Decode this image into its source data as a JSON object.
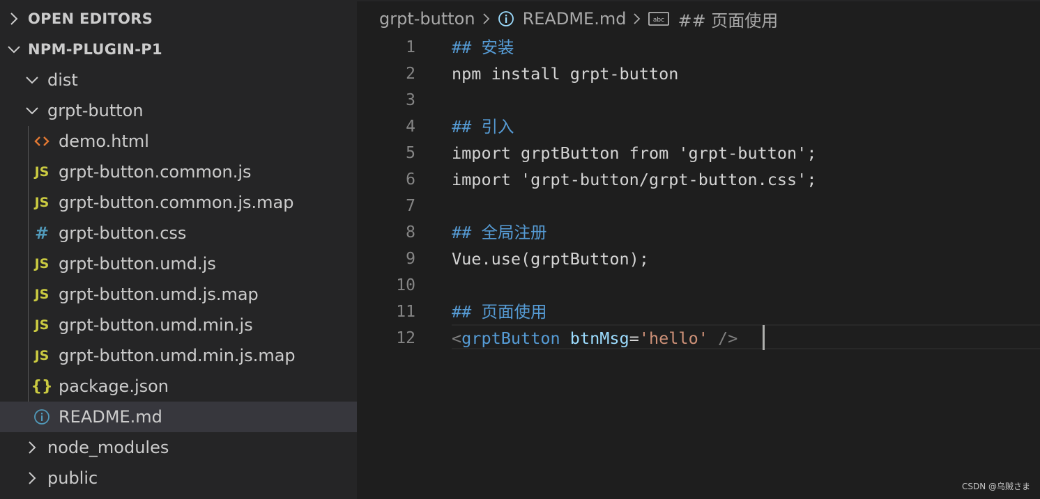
{
  "explorer": {
    "open_editors_label": "OPEN EDITORS",
    "project_label": "NPM-PLUGIN-P1",
    "tree": [
      {
        "label": "dist",
        "kind": "folder",
        "state": "expanded"
      },
      {
        "label": "grpt-button",
        "kind": "folder",
        "state": "expanded"
      },
      {
        "label": "demo.html",
        "kind": "file",
        "icon": "html-icon",
        "icon_text": "<>"
      },
      {
        "label": "grpt-button.common.js",
        "kind": "file",
        "icon": "js-icon",
        "icon_text": "JS"
      },
      {
        "label": "grpt-button.common.js.map",
        "kind": "file",
        "icon": "js-icon",
        "icon_text": "JS"
      },
      {
        "label": "grpt-button.css",
        "kind": "file",
        "icon": "css-icon",
        "icon_text": "#"
      },
      {
        "label": "grpt-button.umd.js",
        "kind": "file",
        "icon": "js-icon",
        "icon_text": "JS"
      },
      {
        "label": "grpt-button.umd.js.map",
        "kind": "file",
        "icon": "js-icon",
        "icon_text": "JS"
      },
      {
        "label": "grpt-button.umd.min.js",
        "kind": "file",
        "icon": "js-icon",
        "icon_text": "JS"
      },
      {
        "label": "grpt-button.umd.min.js.map",
        "kind": "file",
        "icon": "js-icon",
        "icon_text": "JS"
      },
      {
        "label": "package.json",
        "kind": "file",
        "icon": "json-icon",
        "icon_text": "{}"
      },
      {
        "label": "README.md",
        "kind": "file",
        "icon": "info-icon",
        "selected": true
      },
      {
        "label": "node_modules",
        "kind": "folder",
        "state": "collapsed"
      },
      {
        "label": "public",
        "kind": "folder",
        "state": "collapsed"
      }
    ]
  },
  "breadcrumb": {
    "folder": "grpt-button",
    "file": "README.md",
    "symbol": "## 页面使用"
  },
  "editor": {
    "line_numbers": [
      "1",
      "2",
      "3",
      "4",
      "5",
      "6",
      "7",
      "8",
      "9",
      "10",
      "11",
      "12"
    ],
    "lines": {
      "l1_hash": "## ",
      "l1_text": "安装",
      "l2": "npm install grpt-button",
      "l4_hash": "## ",
      "l4_text": "引入",
      "l5": "import grptButton from 'grpt-button';",
      "l6": "import 'grpt-button/grpt-button.css';",
      "l8_hash": "## ",
      "l8_text": "全局注册",
      "l9": "Vue.use(grptButton);",
      "l11_hash": "## ",
      "l11_text": "页面使用",
      "l12_open": "<",
      "l12_tag": "grptButton",
      "l12_space": " ",
      "l12_attr": "btnMsg",
      "l12_eq": "=",
      "l12_val": "'hello'",
      "l12_close": " />"
    }
  },
  "watermark": "CSDN @乌贼さま",
  "colors": {
    "sidebar_bg": "#252526",
    "editor_bg": "#1e1e1e",
    "selected_row": "#37373d",
    "heading": "#569cd6",
    "attr": "#9cdcfe",
    "string": "#ce9178",
    "js_icon": "#cbcb41",
    "html_icon": "#e37933",
    "css_icon": "#519aba"
  }
}
